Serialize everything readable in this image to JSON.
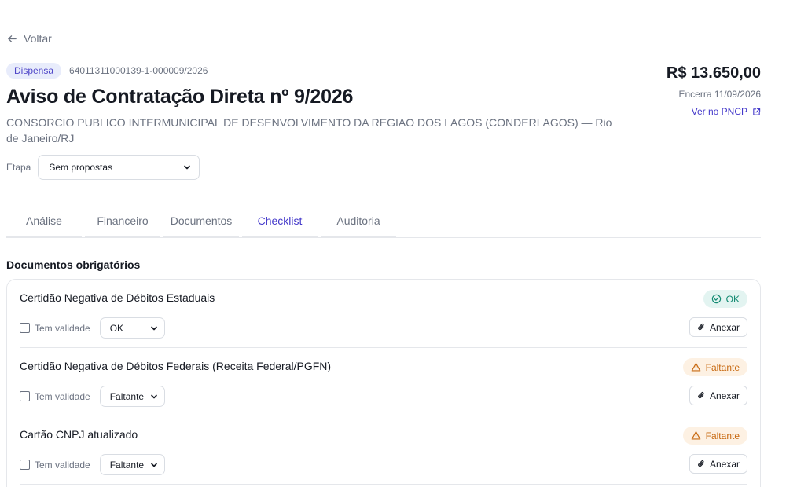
{
  "nav": {
    "back_label": "Voltar"
  },
  "header": {
    "type_badge": "Dispensa",
    "identifier": "64011311000139-1-000009/2026",
    "title": "Aviso de Contratação Direta nº 9/2026",
    "organization": "CONSORCIO PUBLICO INTERMUNICIPAL DE DESENVOLVIMENTO DA REGIAO DOS LAGOS (CONDERLAGOS) — Rio de Janeiro/RJ",
    "value": "R$ 13.650,00",
    "closes": "Encerra 11/09/2026",
    "pncp_link": "Ver no PNCP"
  },
  "stage": {
    "label": "Etapa",
    "selected": "Sem propostas"
  },
  "tabs": [
    {
      "label": "Análise",
      "active": false
    },
    {
      "label": "Financeiro",
      "active": false
    },
    {
      "label": "Documentos",
      "active": false
    },
    {
      "label": "Checklist",
      "active": true
    },
    {
      "label": "Auditoria",
      "active": false
    }
  ],
  "checklist": {
    "section_title": "Documentos obrigatórios",
    "validity_label": "Tem validade",
    "attach_label": "Anexar",
    "items": [
      {
        "name": "Certidão Negativa de Débitos Estaduais",
        "status_badge": "OK",
        "status_select": "OK",
        "has_validity": false
      },
      {
        "name": "Certidão Negativa de Débitos Federais (Receita Federal/PGFN)",
        "status_badge": "Faltante",
        "status_select": "Faltante",
        "has_validity": false
      },
      {
        "name": "Cartão CNPJ atualizado",
        "status_badge": "Faltante",
        "status_select": "Faltante",
        "has_validity": false
      }
    ]
  },
  "colors": {
    "accent": "#4338ca",
    "ok": "#138a72",
    "missing": "#c86a12"
  }
}
